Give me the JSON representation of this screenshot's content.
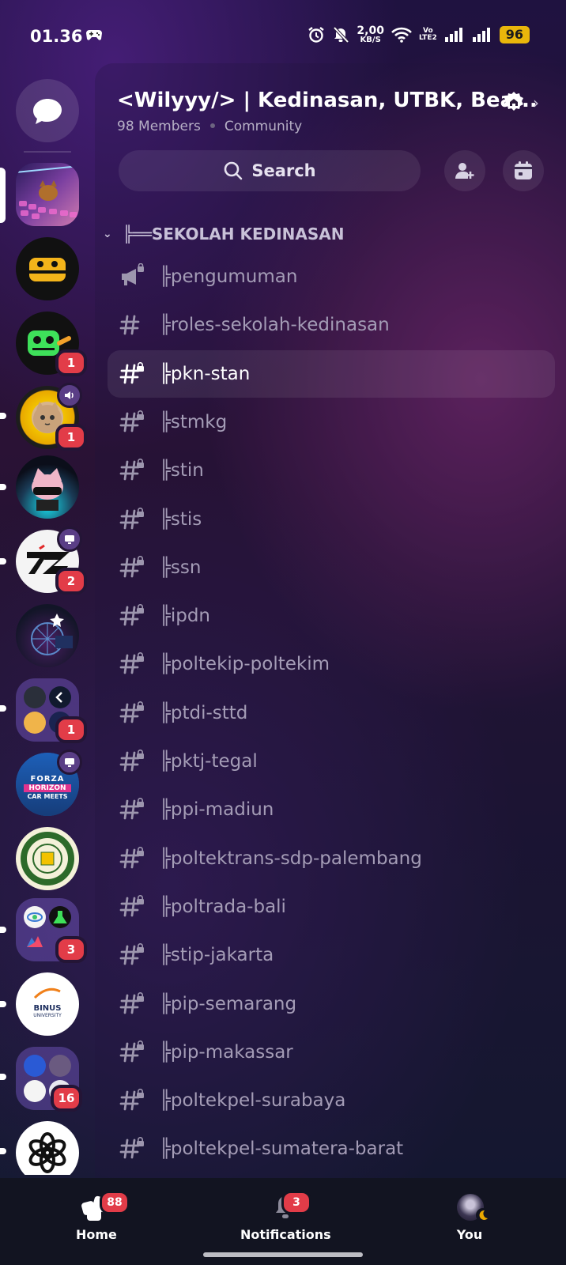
{
  "status_bar": {
    "time": "01.36",
    "speed_value": "2,00",
    "speed_unit": "KB/S",
    "network_label_top": "Vo",
    "network_label_bottom": "LTE2",
    "battery": "96",
    "icons": [
      "game-controller-icon",
      "alarm-icon",
      "mute-bell-icon",
      "wifi-icon",
      "signal-icon",
      "signal-icon"
    ]
  },
  "rail": {
    "items": [
      {
        "name": "direct-messages",
        "icon": "chat-bubble-icon"
      },
      {
        "name": "server-keyboard-cat",
        "selected": true
      },
      {
        "name": "server-yellow-bot"
      },
      {
        "name": "server-green-bot",
        "badge": "1"
      },
      {
        "name": "server-sunflower-cat",
        "badge": "1",
        "subicon": "speaker-icon"
      },
      {
        "name": "server-helmet-cat"
      },
      {
        "name": "server-7z-logo",
        "badge": "2",
        "subicon": "screen-share-icon"
      },
      {
        "name": "server-anime-art"
      },
      {
        "name": "server-folder-1",
        "badge": "1"
      },
      {
        "name": "server-forza-horizon",
        "subicon": "screen-share-icon"
      },
      {
        "name": "server-university-seal"
      },
      {
        "name": "server-folder-2",
        "badge": "3"
      },
      {
        "name": "server-binus-university"
      },
      {
        "name": "server-folder-3",
        "badge": "16"
      },
      {
        "name": "server-openai"
      }
    ],
    "forza_text": [
      "FORZA",
      "HORIZON",
      "CAR MEETS"
    ],
    "binus_text": [
      "BINUS",
      "UNIVERSITY"
    ]
  },
  "header": {
    "server_name": "<Wilyyy/> | Kedinasan, UTBK, Bea...",
    "members": "98 Members",
    "type": "Community",
    "search_label": "Search"
  },
  "category": {
    "name": "╠══SEKOLAH KEDINASAN"
  },
  "channels": [
    {
      "name": "╠pengumuman",
      "type": "announcement",
      "locked": true,
      "selected": false
    },
    {
      "name": "╠roles-sekolah-kedinasan",
      "type": "text",
      "locked": false,
      "selected": false
    },
    {
      "name": "╠pkn-stan",
      "type": "text",
      "locked": true,
      "selected": true
    },
    {
      "name": "╠stmkg",
      "type": "text",
      "locked": true,
      "selected": false
    },
    {
      "name": "╠stin",
      "type": "text",
      "locked": true,
      "selected": false
    },
    {
      "name": "╠stis",
      "type": "text",
      "locked": true,
      "selected": false
    },
    {
      "name": "╠ssn",
      "type": "text",
      "locked": true,
      "selected": false
    },
    {
      "name": "╠ipdn",
      "type": "text",
      "locked": true,
      "selected": false
    },
    {
      "name": "╠poltekip-poltekim",
      "type": "text",
      "locked": true,
      "selected": false
    },
    {
      "name": "╠ptdi-sttd",
      "type": "text",
      "locked": true,
      "selected": false
    },
    {
      "name": "╠pktj-tegal",
      "type": "text",
      "locked": true,
      "selected": false
    },
    {
      "name": "╠ppi-madiun",
      "type": "text",
      "locked": true,
      "selected": false
    },
    {
      "name": "╠poltektrans-sdp-palembang",
      "type": "text",
      "locked": true,
      "selected": false
    },
    {
      "name": "╠poltrada-bali",
      "type": "text",
      "locked": true,
      "selected": false
    },
    {
      "name": "╠stip-jakarta",
      "type": "text",
      "locked": true,
      "selected": false
    },
    {
      "name": "╠pip-semarang",
      "type": "text",
      "locked": true,
      "selected": false
    },
    {
      "name": "╠pip-makassar",
      "type": "text",
      "locked": true,
      "selected": false
    },
    {
      "name": "╠poltekpel-surabaya",
      "type": "text",
      "locked": true,
      "selected": false
    },
    {
      "name": "╠poltekpel-sumatera-barat",
      "type": "text",
      "locked": true,
      "selected": false
    }
  ],
  "bottom_nav": {
    "home_label": "Home",
    "home_badge": "88",
    "notifications_label": "Notifications",
    "notifications_badge": "3",
    "you_label": "You"
  },
  "colors": {
    "badge": "#e23c48",
    "battery": "#e9b60b",
    "muted_text": "#a49cb6",
    "nav_bg": "#121421"
  }
}
